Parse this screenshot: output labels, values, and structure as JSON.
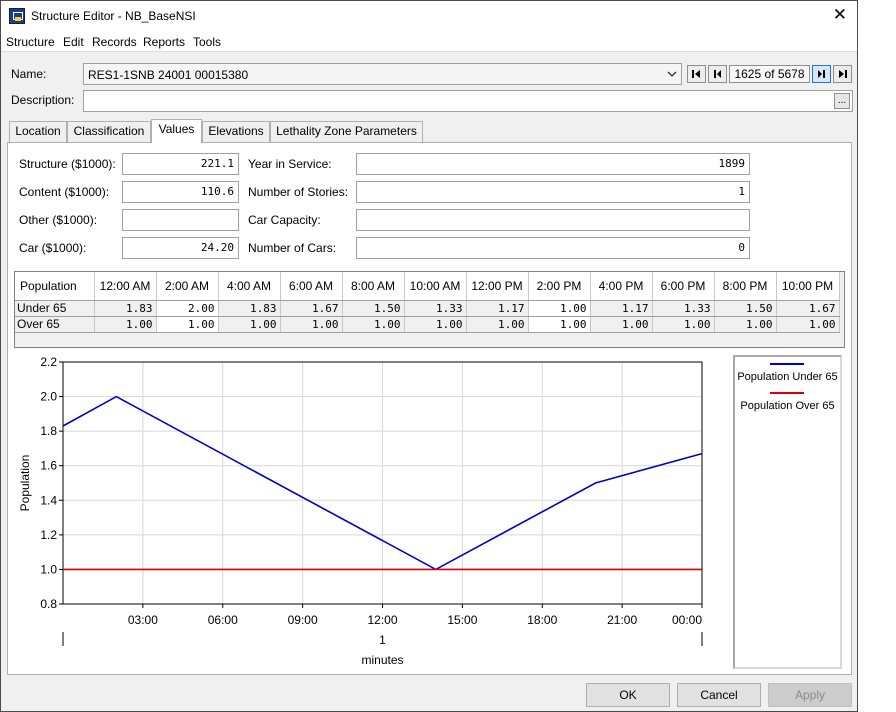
{
  "window": {
    "title": "Structure Editor - NB_BaseNSI",
    "close_glyph": "✕"
  },
  "menu": [
    "Structure",
    "Edit",
    "Records",
    "Reports",
    "Tools"
  ],
  "header": {
    "name_label": "Name:",
    "name_value": "RES1-1SNB 24001 00015380",
    "description_label": "Description:",
    "description_value": "",
    "record_counter": "1625 of 5678",
    "ellipsis": "..."
  },
  "tabs": [
    "Location",
    "Classification",
    "Values",
    "Elevations",
    "Lethality Zone Parameters"
  ],
  "active_tab": "Values",
  "values": {
    "structure_label": "Structure ($1000):",
    "structure_value": "221.1",
    "content_label": "Content ($1000):",
    "content_value": "110.6",
    "other_label": "Other ($1000):",
    "other_value": "",
    "car_label": "Car ($1000):",
    "car_value": "24.20",
    "year_label": "Year in Service:",
    "year_value": "1899",
    "stories_label": "Number of Stories:",
    "stories_value": "1",
    "car_capacity_label": "Car Capacity:",
    "car_capacity_value": "",
    "num_cars_label": "Number of Cars:",
    "num_cars_value": "0"
  },
  "population_table": {
    "header": "Population",
    "columns": [
      "12:00 AM",
      "2:00 AM",
      "4:00 AM",
      "6:00 AM",
      "8:00 AM",
      "10:00 AM",
      "12:00 PM",
      "2:00 PM",
      "4:00 PM",
      "6:00 PM",
      "8:00 PM",
      "10:00 PM"
    ],
    "rows": [
      {
        "label": "Under 65",
        "values": [
          "1.83",
          "2.00",
          "1.83",
          "1.67",
          "1.50",
          "1.33",
          "1.17",
          "1.00",
          "1.17",
          "1.33",
          "1.50",
          "1.67"
        ]
      },
      {
        "label": "Over 65",
        "values": [
          "1.00",
          "1.00",
          "1.00",
          "1.00",
          "1.00",
          "1.00",
          "1.00",
          "1.00",
          "1.00",
          "1.00",
          "1.00",
          "1.00"
        ]
      }
    ]
  },
  "chart_data": {
    "type": "line",
    "ylabel": "Population",
    "xlabel_day": "1",
    "xlabel": "minutes",
    "ylim": [
      0.8,
      2.2
    ],
    "yticks": [
      "0.8",
      "1.0",
      "1.2",
      "1.4",
      "1.6",
      "1.8",
      "2.0",
      "2.2"
    ],
    "xticks": [
      "03:00",
      "06:00",
      "09:00",
      "12:00",
      "15:00",
      "18:00",
      "21:00",
      "00:00"
    ],
    "grid": true,
    "legend_placement": "right",
    "series": [
      {
        "name": "Population Under 65",
        "color": "#0000cc",
        "x": [
          "00:00",
          "02:00",
          "14:00",
          "20:00",
          "24:00"
        ],
        "values": [
          1.83,
          2.0,
          1.0,
          1.5,
          1.67
        ]
      },
      {
        "name": "Population Over 65",
        "color": "#dd0000",
        "x": [
          "00:00",
          "24:00"
        ],
        "values": [
          1.0,
          1.0
        ]
      }
    ]
  },
  "buttons": {
    "ok": "OK",
    "cancel": "Cancel",
    "apply": "Apply"
  }
}
